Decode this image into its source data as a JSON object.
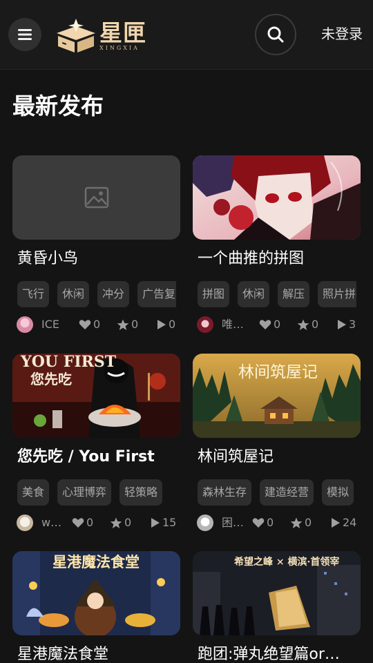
{
  "header": {
    "logo_text": "星匣",
    "logo_subtitle": "XINGXIA",
    "login_label": "未登录"
  },
  "section_title": "最新发布",
  "cards": [
    {
      "title": "黄昏小鸟",
      "tags": [
        "飞行",
        "休闲",
        "冲分",
        "广告复"
      ],
      "author": "ICE",
      "likes": "0",
      "stars": "0",
      "plays": "0",
      "cover": "placeholder"
    },
    {
      "title": "一个曲推的拼图",
      "tags": [
        "拼图",
        "休闲",
        "解压",
        "照片拼"
      ],
      "author": "唯…",
      "likes": "0",
      "stars": "0",
      "plays": "3",
      "cover": "anime-portrait"
    },
    {
      "title": "您先吃 / You First",
      "cover_text_top": "YOU FIRST",
      "cover_text_bottom": "您先吃",
      "tags": [
        "美食",
        "心理博弈",
        "轻策略"
      ],
      "author": "w…",
      "likes": "0",
      "stars": "0",
      "plays": "15",
      "cover": "dinner-scene"
    },
    {
      "title": "林间筑屋记",
      "cover_text": "林间筑屋记",
      "tags": [
        "森林生存",
        "建造经营",
        "模拟"
      ],
      "author": "困…",
      "likes": "0",
      "stars": "0",
      "plays": "24",
      "cover": "forest-cabin"
    },
    {
      "title": "星港魔法食堂",
      "cover_text": "星港魔法食堂",
      "cover": "magic-canteen"
    },
    {
      "title": "跑团:弹丸绝望篇or…",
      "cover_text": "希望之峰 × 横滨·首领宰",
      "cover": "dark-city"
    }
  ],
  "colors": {
    "background": "#141414",
    "header": "#1a1a1a",
    "logo_gold": "#f1d6ae",
    "tag_bg": "#2e2e2e",
    "muted_text": "#9a9a9a"
  },
  "icons": [
    "menu-icon",
    "logo-box-icon",
    "search-icon",
    "image-placeholder-icon",
    "heart-icon",
    "star-icon",
    "play-icon"
  ]
}
